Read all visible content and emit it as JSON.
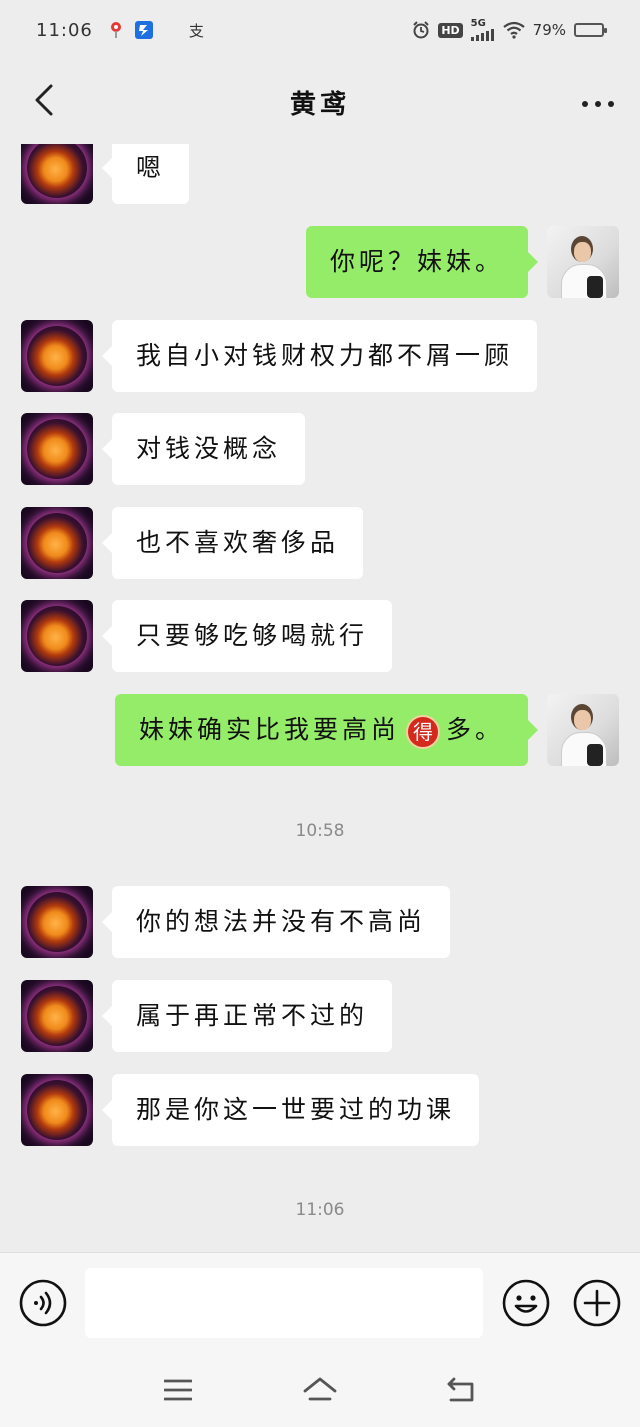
{
  "status_bar": {
    "time": "11:06",
    "left_icons": [
      "pin-icon",
      "app-icon",
      "alipay-icon"
    ],
    "alipay_glyph": "支",
    "hd_label": "HD",
    "network_label": "5G",
    "battery_percent": "79%",
    "battery_level": 0.79
  },
  "header": {
    "title": "黄鸢",
    "back_icon": "chevron-left-icon",
    "more_icon": "more-dots-icon"
  },
  "messages": [
    {
      "side": "left",
      "text": "嗯"
    },
    {
      "side": "right",
      "text": "你呢？妹妹。"
    },
    {
      "side": "left",
      "text": "我自小对钱财权力都不屑一顾"
    },
    {
      "side": "left",
      "text": "对钱没概念"
    },
    {
      "side": "left",
      "text": "也不喜欢奢侈品"
    },
    {
      "side": "left",
      "text": "只要够吃够喝就行"
    },
    {
      "side": "right",
      "text_before": "妹妹确实比我要高尚",
      "emoji": "得",
      "text_after": "多。"
    },
    {
      "side": "left",
      "text": "你的想法并没有不高尚"
    },
    {
      "side": "left",
      "text": "属于再正常不过的"
    },
    {
      "side": "left",
      "text": "那是你这一世要过的功课"
    }
  ],
  "timestamps": [
    "10:58",
    "11:06"
  ],
  "input_bar": {
    "placeholder": "",
    "voice_icon": "voice-icon",
    "emoji_icon": "smiley-icon",
    "plus_icon": "plus-icon"
  },
  "system_nav": [
    "menu-icon",
    "home-icon",
    "back-icon"
  ],
  "colors": {
    "background": "#ededed",
    "bubble_self": "#95ec69",
    "bubble_other": "#ffffff"
  }
}
